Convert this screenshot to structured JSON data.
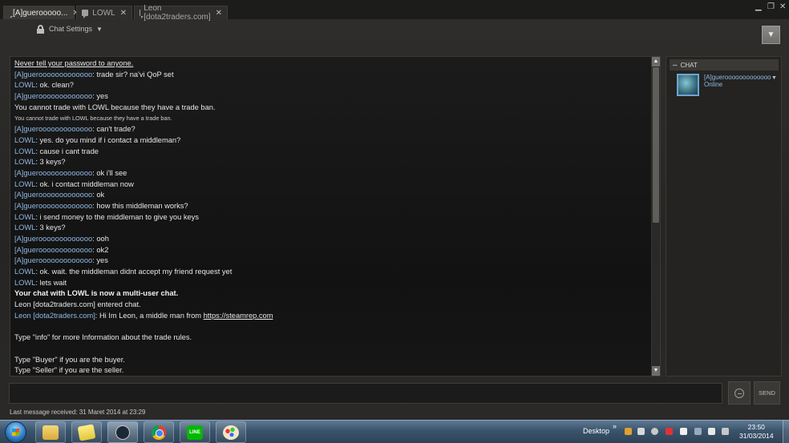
{
  "tabs": [
    {
      "label": "[A]guerooooo..."
    },
    {
      "label": "LOWL"
    },
    {
      "label": "Leon [dota2traders.com]"
    }
  ],
  "window_controls": {
    "minimize": "▁",
    "restore": "❐",
    "close": "✕"
  },
  "header": {
    "chat_settings_label": "Chat Settings"
  },
  "chat_lines": [
    {
      "segments": [
        {
          "text": "Never tell your password to anyone.",
          "kind": "system"
        }
      ],
      "style": "under"
    },
    {
      "segments": [
        {
          "text": "[A]guerooooooooooooo",
          "kind": "name"
        },
        {
          "text": ": trade sir? na'vi QoP set",
          "kind": "msg"
        }
      ]
    },
    {
      "segments": [
        {
          "text": "LOWL",
          "kind": "name"
        },
        {
          "text": ": ok. clean?",
          "kind": "msg"
        }
      ]
    },
    {
      "segments": [
        {
          "text": "[A]guerooooooooooooo",
          "kind": "name"
        },
        {
          "text": ": yes",
          "kind": "msg"
        }
      ]
    },
    {
      "segments": [
        {
          "text": "You cannot trade with LOWL because they have a trade ban.",
          "kind": "system"
        }
      ]
    },
    {
      "segments": [
        {
          "text": "You cannot trade with LOWL because they have a trade ban.",
          "kind": "system"
        }
      ],
      "style": "small"
    },
    {
      "segments": [
        {
          "text": "[A]guerooooooooooooo",
          "kind": "name"
        },
        {
          "text": ": can't trade?",
          "kind": "msg"
        }
      ]
    },
    {
      "segments": [
        {
          "text": "LOWL",
          "kind": "name"
        },
        {
          "text": ": yes. do you mind if i contact a middleman?",
          "kind": "msg"
        }
      ]
    },
    {
      "segments": [
        {
          "text": "LOWL",
          "kind": "name"
        },
        {
          "text": ": cause i cant trade",
          "kind": "msg"
        }
      ]
    },
    {
      "segments": [
        {
          "text": "LOWL",
          "kind": "name"
        },
        {
          "text": ": 3 keys?",
          "kind": "msg"
        }
      ]
    },
    {
      "segments": [
        {
          "text": "[A]guerooooooooooooo",
          "kind": "name"
        },
        {
          "text": ": ok i'll see",
          "kind": "msg"
        }
      ]
    },
    {
      "segments": [
        {
          "text": "LOWL",
          "kind": "name"
        },
        {
          "text": ": ok. i contact middleman now",
          "kind": "msg"
        }
      ]
    },
    {
      "segments": [
        {
          "text": "[A]guerooooooooooooo",
          "kind": "name"
        },
        {
          "text": ": ok",
          "kind": "msg"
        }
      ]
    },
    {
      "segments": [
        {
          "text": "[A]guerooooooooooooo",
          "kind": "name"
        },
        {
          "text": ": how this middleman works?",
          "kind": "msg"
        }
      ]
    },
    {
      "segments": [
        {
          "text": "LOWL",
          "kind": "name"
        },
        {
          "text": ": i send money to the middleman to give you keys",
          "kind": "msg"
        }
      ]
    },
    {
      "segments": [
        {
          "text": "LOWL",
          "kind": "name"
        },
        {
          "text": ": 3 keys?",
          "kind": "msg"
        }
      ]
    },
    {
      "segments": [
        {
          "text": "[A]guerooooooooooooo",
          "kind": "name"
        },
        {
          "text": ": ooh",
          "kind": "msg"
        }
      ]
    },
    {
      "segments": [
        {
          "text": "[A]guerooooooooooooo",
          "kind": "name"
        },
        {
          "text": ": ok2",
          "kind": "msg"
        }
      ]
    },
    {
      "segments": [
        {
          "text": "[A]guerooooooooooooo",
          "kind": "name"
        },
        {
          "text": ": yes",
          "kind": "msg"
        }
      ]
    },
    {
      "segments": [
        {
          "text": "LOWL",
          "kind": "name"
        },
        {
          "text": ": ok. wait. the middleman didnt accept my friend request yet",
          "kind": "msg"
        }
      ]
    },
    {
      "segments": [
        {
          "text": "LOWL",
          "kind": "name"
        },
        {
          "text": ": lets wait",
          "kind": "msg"
        }
      ]
    },
    {
      "segments": [
        {
          "text": "Your chat with LOWL is now a multi-user chat.",
          "kind": "system"
        }
      ],
      "style": "bold"
    },
    {
      "segments": [
        {
          "text": "Leon [dota2traders.com] entered chat.",
          "kind": "system"
        }
      ]
    },
    {
      "segments": [
        {
          "text": "Leon [dota2traders.com]",
          "kind": "name"
        },
        {
          "text": ": Hi Im Leon, a middle man from ",
          "kind": "msg"
        },
        {
          "text": "https://steamrep.com",
          "kind": "link"
        }
      ]
    },
    {
      "segments": [
        {
          "text": "",
          "kind": "msg"
        }
      ]
    },
    {
      "segments": [
        {
          "text": "Type \"info\" for more Information about the trade rules.",
          "kind": "msg"
        }
      ]
    },
    {
      "segments": [
        {
          "text": "",
          "kind": "msg"
        }
      ]
    },
    {
      "segments": [
        {
          "text": "Type \"Buyer\" if you are the buyer.",
          "kind": "msg"
        }
      ]
    },
    {
      "segments": [
        {
          "text": "Type \"Seller\" if you are the seller.",
          "kind": "msg"
        }
      ]
    }
  ],
  "member_panel": {
    "heading": "CHAT",
    "members": [
      {
        "name": "[A]guerooooooooooooo",
        "status": "Online"
      }
    ]
  },
  "composer": {
    "send_label": "SEND",
    "input_value": ""
  },
  "status_bar": {
    "last_message": "Last message received: 31 Maret 2014 at 23:29"
  },
  "taskbar": {
    "buttons": [
      "folder",
      "sticky-notes",
      "steam",
      "chrome",
      "line",
      "paint"
    ],
    "line_label": "LINE",
    "desktop_label": "Desktop",
    "toolbar_chevron": "»",
    "time": "23:50",
    "date": "31/03/2014"
  },
  "colors": {
    "name_blue": "#8fb9e4",
    "chat_bg": "#121212",
    "window_bg": "#2b2a28"
  }
}
